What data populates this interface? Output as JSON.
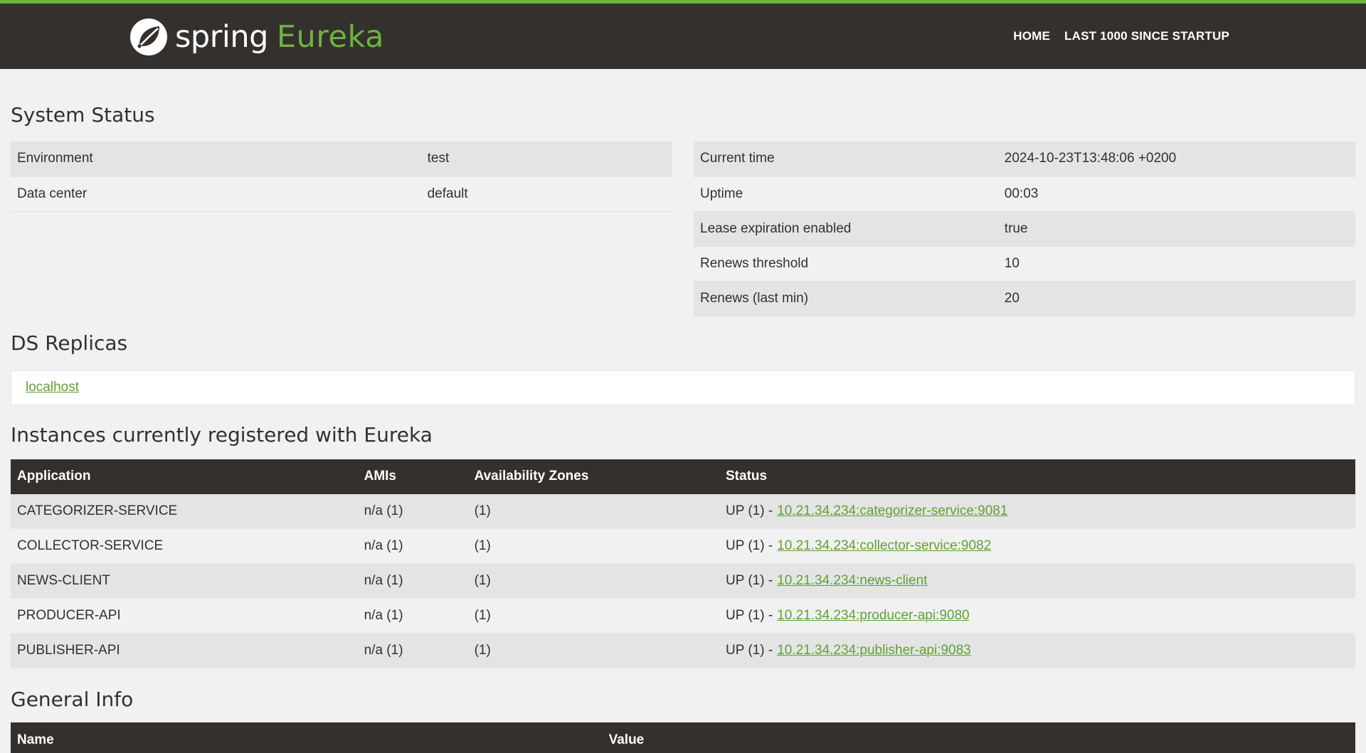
{
  "header": {
    "brand_word": "spring",
    "brand_product": "Eureka",
    "nav": [
      {
        "label": "HOME"
      },
      {
        "label": "LAST 1000 SINCE STARTUP"
      }
    ]
  },
  "system_status": {
    "title": "System Status",
    "left": [
      {
        "key": "Environment",
        "value": "test"
      },
      {
        "key": "Data center",
        "value": "default"
      }
    ],
    "right": [
      {
        "key": "Current time",
        "value": "2024-10-23T13:48:06 +0200"
      },
      {
        "key": "Uptime",
        "value": "00:03"
      },
      {
        "key": "Lease expiration enabled",
        "value": "true"
      },
      {
        "key": "Renews threshold",
        "value": "10"
      },
      {
        "key": "Renews (last min)",
        "value": "20"
      }
    ]
  },
  "ds_replicas": {
    "title": "DS Replicas",
    "link": "localhost"
  },
  "instances": {
    "title": "Instances currently registered with Eureka",
    "columns": [
      "Application",
      "AMIs",
      "Availability Zones",
      "Status"
    ],
    "rows": [
      {
        "app": "CATEGORIZER-SERVICE",
        "amis": "n/a (1)",
        "zones": "(1)",
        "status": "UP (1) -",
        "link": "10.21.34.234:categorizer-service:9081"
      },
      {
        "app": "COLLECTOR-SERVICE",
        "amis": "n/a (1)",
        "zones": "(1)",
        "status": "UP (1) -",
        "link": "10.21.34.234:collector-service:9082"
      },
      {
        "app": "NEWS-CLIENT",
        "amis": "n/a (1)",
        "zones": "(1)",
        "status": "UP (1) -",
        "link": "10.21.34.234:news-client"
      },
      {
        "app": "PRODUCER-API",
        "amis": "n/a (1)",
        "zones": "(1)",
        "status": "UP (1) -",
        "link": "10.21.34.234:producer-api:9080"
      },
      {
        "app": "PUBLISHER-API",
        "amis": "n/a (1)",
        "zones": "(1)",
        "status": "UP (1) -",
        "link": "10.21.34.234:publisher-api:9083"
      }
    ]
  },
  "general_info": {
    "title": "General Info",
    "columns": [
      "Name",
      "Value"
    ]
  },
  "colors": {
    "header_bg": "#34302d",
    "accent": "#6db33f",
    "link": "#5fa134",
    "page_bg": "#f1f1f1"
  },
  "icons": {
    "brand": "spring-leaf-icon"
  }
}
